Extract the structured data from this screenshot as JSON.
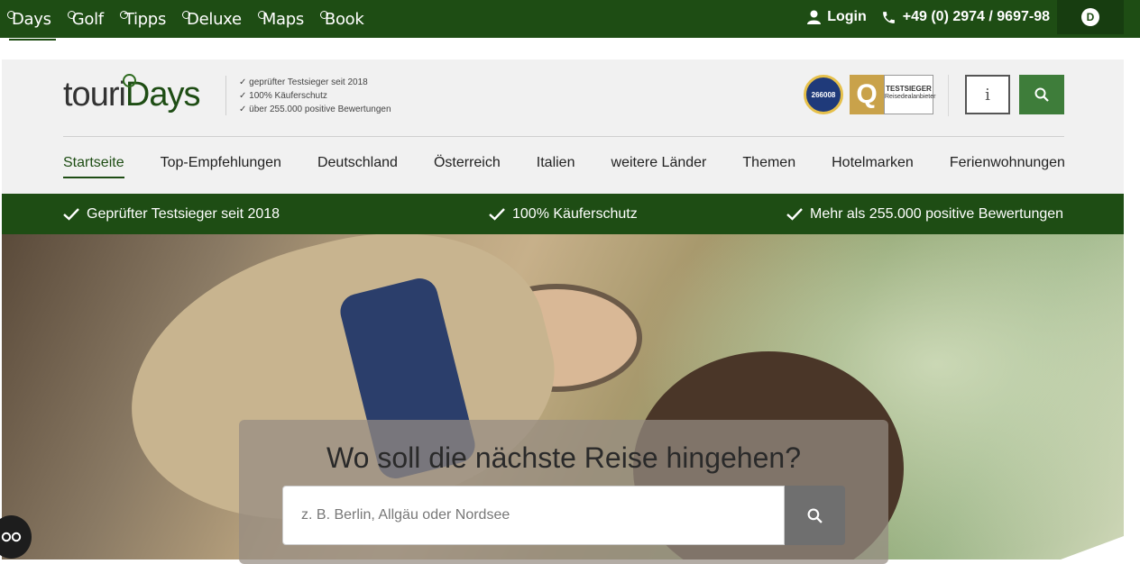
{
  "topbar": {
    "brands": [
      "Days",
      "Golf",
      "Tipps",
      "Deluxe",
      "Maps",
      "Book"
    ],
    "login_label": "Login",
    "phone": "+49 (0) 2974 / 9697-98",
    "avatar_letter": "D"
  },
  "header": {
    "logo_part1": "touri",
    "logo_part2": "Days",
    "trust_points": [
      "geprüfter Testsieger seit 2018",
      "100% Käuferschutz",
      "über 255.000 positive Bewertungen"
    ],
    "seal_blue_text": "266008",
    "seal_q_text": "Q",
    "seal_test_title": "TESTSIEGER",
    "seal_test_sub": "Reisedealanbieter",
    "info_label": "i"
  },
  "nav": {
    "items": [
      "Startseite",
      "Top-Empfehlungen",
      "Deutschland",
      "Österreich",
      "Italien",
      "weitere Länder",
      "Themen",
      "Hotelmarken",
      "Ferienwohnungen"
    ],
    "active": "Startseite"
  },
  "benefits": [
    "Geprüfter Testsieger seit 2018",
    "100% Käuferschutz",
    "Mehr als 255.000 positive Bewertungen"
  ],
  "hero": {
    "title": "Wo soll die nächste Reise hingehen?",
    "search_placeholder": "z. B. Berlin, Allgäu oder Nordsee"
  },
  "colors": {
    "brand_green": "#1e4d14",
    "button_green": "#3e7d3a",
    "header_bg": "#f1f1f1"
  }
}
